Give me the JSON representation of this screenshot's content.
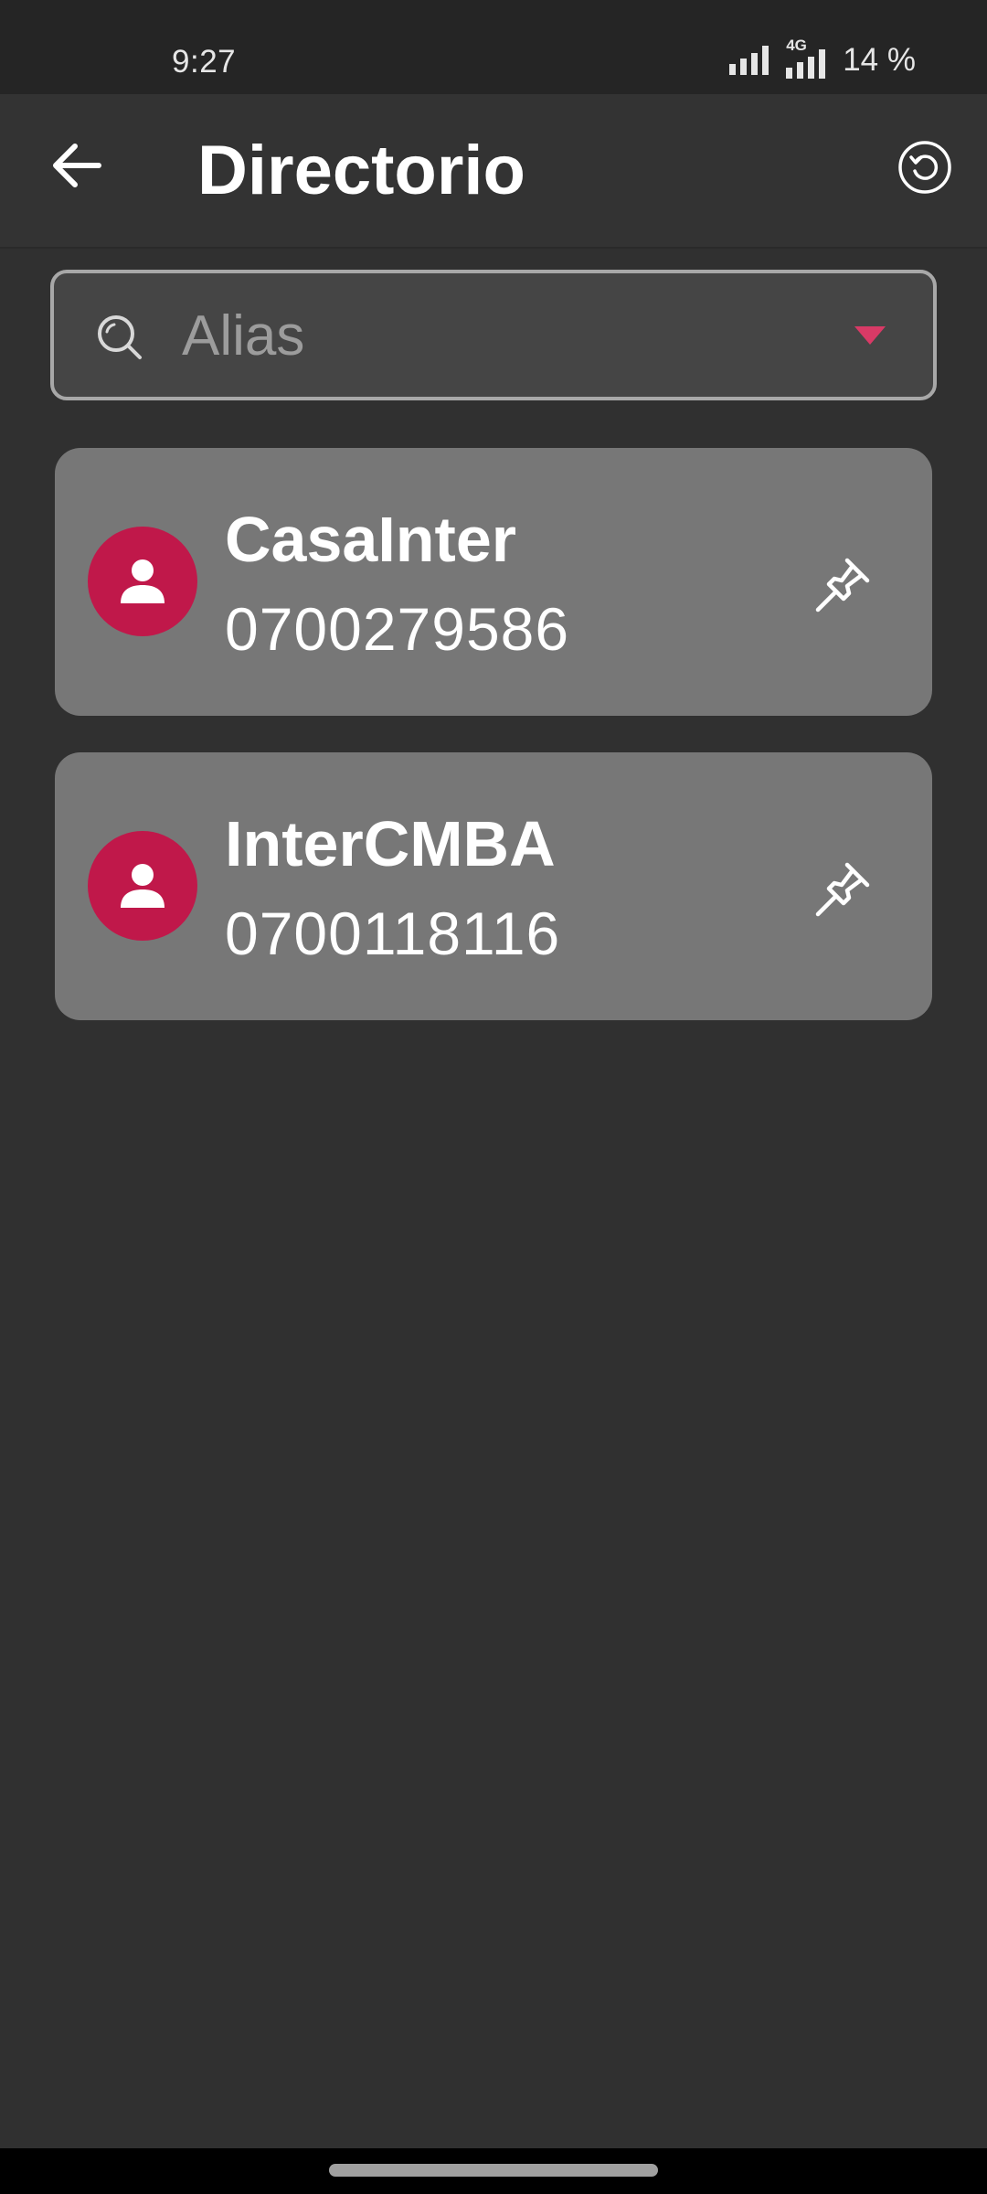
{
  "status_bar": {
    "time": "9:27",
    "network": "4G",
    "battery": "14 %"
  },
  "app_bar": {
    "title": "Directorio",
    "back_icon": "arrow-left-icon",
    "refresh_icon": "refresh-icon"
  },
  "search": {
    "placeholder": "Alias",
    "value": "",
    "icon": "search-icon",
    "dropdown_icon": "triangle-down-icon"
  },
  "contacts": [
    {
      "name": "CasaInter",
      "number": "0700279586",
      "avatar_icon": "person-icon",
      "pin_icon": "pin-icon"
    },
    {
      "name": "InterCMBA",
      "number": "0700118116",
      "avatar_icon": "person-icon",
      "pin_icon": "pin-icon"
    }
  ],
  "colors": {
    "background": "#303030",
    "app_bar": "#333333",
    "card": "#777777",
    "accent": "#c0184a",
    "dropdown_arrow": "#d83a66"
  }
}
